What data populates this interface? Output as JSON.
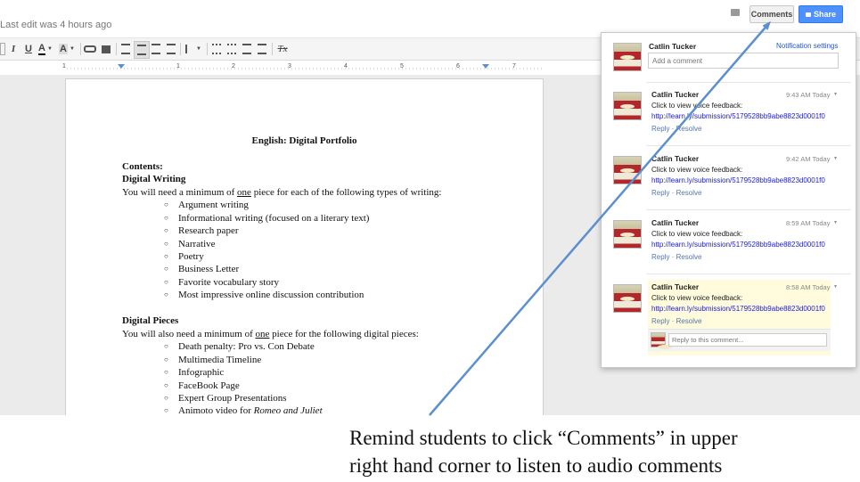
{
  "header": {
    "last_edit": "Last edit was 4 hours ago",
    "comments_label": "Comments",
    "share_label": "Share"
  },
  "toolbar": {
    "italic": "I",
    "underline": "U",
    "text_color": "A",
    "highlight": "A",
    "clear_format": "Tx"
  },
  "ruler": {
    "marks": [
      "1",
      "1",
      "2",
      "3",
      "4",
      "5",
      "6",
      "7"
    ]
  },
  "doc": {
    "title": "English: Digital Portfolio",
    "contents_heading": "Contents:",
    "section1_heading": "Digital Writing",
    "section1_intro_pre": "You will need a minimum of ",
    "section1_intro_emph": "one",
    "section1_intro_post": " piece for each of the following types of writing:",
    "section1_items": [
      "Argument writing",
      "Informational writing (focused on a literary text)",
      "Research paper",
      "Narrative",
      "Poetry",
      "Business Letter",
      "Favorite vocabulary story",
      "Most impressive online discussion contribution"
    ],
    "section2_heading": "Digital Pieces",
    "section2_intro_pre": "You will also need a minimum of ",
    "section2_intro_emph": "one",
    "section2_intro_post": " piece for the following digital pieces:",
    "section2_items": [
      "Death penalty: Pro vs. Con Debate",
      "Multimedia Timeline",
      "Infographic",
      "FaceBook Page",
      "Expert Group Presentations"
    ],
    "last_item_pre": "Animoto video for ",
    "last_item_emph": "Romeo and Juliet"
  },
  "panel": {
    "author": "Catlin Tucker",
    "notification_settings": "Notification settings",
    "add_placeholder": "Add a comment",
    "reply_placeholder": "Reply to this comment...",
    "comments": [
      {
        "name": "Catlin Tucker",
        "time": "9:43 AM Today",
        "text": "Click to view voice feedback:",
        "link": "http://learn.ly/submission/5179528bb9abe8823d0001f0",
        "reply": "Reply",
        "resolve": "Resolve"
      },
      {
        "name": "Catlin Tucker",
        "time": "9:42 AM Today",
        "text": "Click to view voice feedback:",
        "link": "http://learn.ly/submission/5179528bb9abe8823d0001f0",
        "reply": "Reply",
        "resolve": "Resolve"
      },
      {
        "name": "Catlin Tucker",
        "time": "8:59 AM Today",
        "text": "Click to view voice feedback:",
        "link": "http://learn.ly/submission/5179528bb9abe8823d0001f0",
        "reply": "Reply",
        "resolve": "Resolve"
      },
      {
        "name": "Catlin Tucker",
        "time": "8:58 AM Today",
        "text": "Click to view voice feedback:",
        "link": "http://learn.ly/submission/5179528bb9abe8823d0001f0",
        "reply": "Reply",
        "resolve": "Resolve"
      }
    ]
  },
  "caption": {
    "line1": "Remind students to click “Comments” in upper",
    "line2": "right hand corner to listen to audio comments"
  },
  "colors": {
    "accent": "#4d90fe",
    "arrow": "#5b8fcf",
    "active_comment_bg": "#fffbdc"
  }
}
